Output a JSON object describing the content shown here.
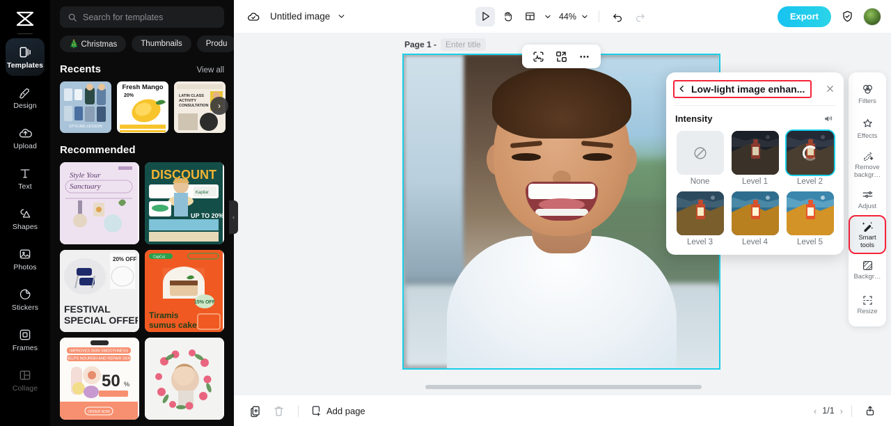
{
  "app": {
    "name": "CapCut",
    "logo_icon": "capcut-logo-icon"
  },
  "sidebar": {
    "items": [
      {
        "label": "Templates",
        "icon": "templates-icon",
        "active": true
      },
      {
        "label": "Design",
        "icon": "design-icon",
        "active": false
      },
      {
        "label": "Upload",
        "icon": "upload-icon",
        "active": false
      },
      {
        "label": "Text",
        "icon": "text-icon",
        "active": false
      },
      {
        "label": "Shapes",
        "icon": "shapes-icon",
        "active": false
      },
      {
        "label": "Photos",
        "icon": "photos-icon",
        "active": false
      },
      {
        "label": "Stickers",
        "icon": "stickers-icon",
        "active": false
      },
      {
        "label": "Frames",
        "icon": "frames-icon",
        "active": false
      },
      {
        "label": "Collage",
        "icon": "collage-icon",
        "active": false
      }
    ]
  },
  "templates_panel": {
    "search": {
      "placeholder": "Search for templates",
      "icon": "search-icon"
    },
    "chips": [
      "🎄 Christmas",
      "Thumbnails",
      "Produ"
    ],
    "recents": {
      "title": "Recents",
      "view_all": "View all",
      "next_icon": "chevron-right-icon",
      "thumbs": [
        "STYLING LESSON",
        "Fresh Mango 20%",
        "LATIN CLASS ACTIVITY CONSULTATION"
      ]
    },
    "recommended": {
      "title": "Recommended",
      "thumbs": [
        "Style Your Sanctuary",
        "DISCOUNT UP TO 20% OFF",
        "FESTIVAL SPECIAL OFFER 20% OFF",
        "Tiramis sumus cake 15% OFF",
        "IMPROVES SKIN SMOOTHNESS 50%",
        "Floral portrait frame"
      ]
    },
    "collapse_icon": "chevron-left-icon"
  },
  "topbar": {
    "cloud_icon": "cloud-saved-icon",
    "doc_title": "Untitled image",
    "title_caret_icon": "chevron-down-icon",
    "select_tool_icon": "cursor-select-icon",
    "hand_tool_icon": "hand-pan-icon",
    "layout_tool_icon": "layout-icon",
    "layout_caret_icon": "chevron-down-icon",
    "zoom_value": "44%",
    "zoom_caret_icon": "chevron-down-icon",
    "undo_icon": "undo-icon",
    "redo_icon": "redo-icon",
    "export_label": "Export",
    "shield_icon": "shield-check-icon",
    "avatar_icon": "user-avatar"
  },
  "canvas": {
    "page_label": "Page 1 -",
    "title_placeholder": "Enter title",
    "selection_color": "#19cfe8",
    "float_tools": [
      {
        "icon": "crop-select-icon"
      },
      {
        "icon": "replace-image-icon"
      },
      {
        "icon": "more-options-icon"
      }
    ],
    "image_alt": "Smiling boy in white t-shirt, blurred outdoor background"
  },
  "popover": {
    "back_icon": "chevron-left-icon",
    "title": "Low-light image enhan...",
    "title_highlight_color": "#f5233a",
    "close_icon": "close-icon",
    "section_label": "Intensity",
    "sound_icon": "speaker-icon",
    "levels": [
      {
        "name": "None",
        "icon": "no-effect-icon",
        "selected": false,
        "loading": false
      },
      {
        "name": "Level 1",
        "icon": "lantern-thumb",
        "selected": false,
        "loading": false
      },
      {
        "name": "Level 2",
        "icon": "lantern-thumb",
        "selected": true,
        "loading": true
      },
      {
        "name": "Level 3",
        "icon": "lantern-thumb",
        "selected": false,
        "loading": false
      },
      {
        "name": "Level 4",
        "icon": "lantern-thumb",
        "selected": false,
        "loading": false
      },
      {
        "name": "Level 5",
        "icon": "lantern-thumb",
        "selected": false,
        "loading": false
      }
    ]
  },
  "right_rail": {
    "items": [
      {
        "label": "Filters",
        "icon": "filters-icon",
        "active": false,
        "marked": false
      },
      {
        "label": "Effects",
        "icon": "effects-icon",
        "active": false,
        "marked": false
      },
      {
        "label": "Remove\nbackgr…",
        "icon": "remove-bg-icon",
        "active": false,
        "marked": false
      },
      {
        "label": "Adjust",
        "icon": "adjust-icon",
        "active": false,
        "marked": false
      },
      {
        "label": "Smart\ntools",
        "icon": "smart-tools-icon",
        "active": true,
        "marked": true
      },
      {
        "label": "Backgr…",
        "icon": "background-icon",
        "active": false,
        "marked": false
      },
      {
        "label": "Resize",
        "icon": "resize-icon",
        "active": false,
        "marked": false
      }
    ],
    "highlight_color": "#f5233a"
  },
  "bottombar": {
    "duplicate_icon": "duplicate-page-icon",
    "delete_icon": "trash-icon",
    "add_page_label": "Add page",
    "add_page_icon": "add-page-icon",
    "prev_icon": "chevron-left-icon",
    "page_indicator": "1/1",
    "next_icon": "chevron-right-icon",
    "export_page_icon": "export-page-icon"
  }
}
